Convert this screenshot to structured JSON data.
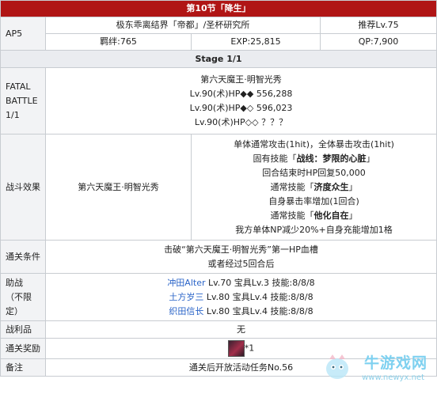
{
  "header": {
    "title": "第10节「降生」"
  },
  "info": {
    "ap": "AP5",
    "location": "极东乖离结界「帝都」/圣杯研究所",
    "recommend": "推荐Lv.75",
    "bond": "羁绊:765",
    "exp": "EXP:25,815",
    "qp": "QP:7,900"
  },
  "stage": {
    "title": "Stage 1/1"
  },
  "battle": {
    "label": [
      "FATAL",
      "BATTLE",
      "1/1"
    ],
    "enemy_name": "第六天魔王·明智光秀",
    "enemies": [
      "Lv.90(术)HP◆◆ 556,288",
      "Lv.90(术)HP◆◇ 596,023",
      "Lv.90(术)HP◇◇ ？？？"
    ]
  },
  "effects": {
    "label": "战斗效果",
    "enemy": "第六天魔王·明智光秀",
    "lines": [
      "单体通常攻击(1hit)，全体暴击攻击(1hit)",
      {
        "prefix": "固有技能「",
        "name": "战线：梦限的心脏",
        "suffix": "」"
      },
      "回合结束时HP回复50,000",
      {
        "prefix": "通常技能「",
        "name": "济度众生",
        "suffix": "」"
      },
      "自身暴击率增加(1回合)",
      {
        "prefix": "通常技能「",
        "name": "他化自在",
        "suffix": "」"
      },
      "我方单体NP减少20%+自身充能增加1格"
    ]
  },
  "clear": {
    "label": "通关条件",
    "line1": "击破“第六天魔王·明智光秀”第一HP血槽",
    "line2": "或者经过5回合后"
  },
  "support": {
    "label": [
      "助战",
      "（不限",
      "定）"
    ],
    "rows": [
      {
        "name": "冲田Alter",
        "detail": " Lv.70 宝具Lv.3 技能:8/8/8",
        "color": "#2a64c8"
      },
      {
        "name": "土方岁三",
        "detail": " Lv.80 宝具Lv.4 技能:8/8/8",
        "color": "#2a64c8"
      },
      {
        "name": "织田信长",
        "detail": " Lv.80 宝具Lv.4 技能:8/8/8",
        "color": "#2a64c8"
      }
    ]
  },
  "drops": {
    "label": "战利品",
    "value": "无"
  },
  "reward": {
    "label": "通关奖励",
    "count": "*1"
  },
  "note": {
    "label": "备注",
    "value": "通关后开放活动任务No.56"
  },
  "watermark": {
    "text": "牛游戏网",
    "url": "www.newyx.net"
  }
}
